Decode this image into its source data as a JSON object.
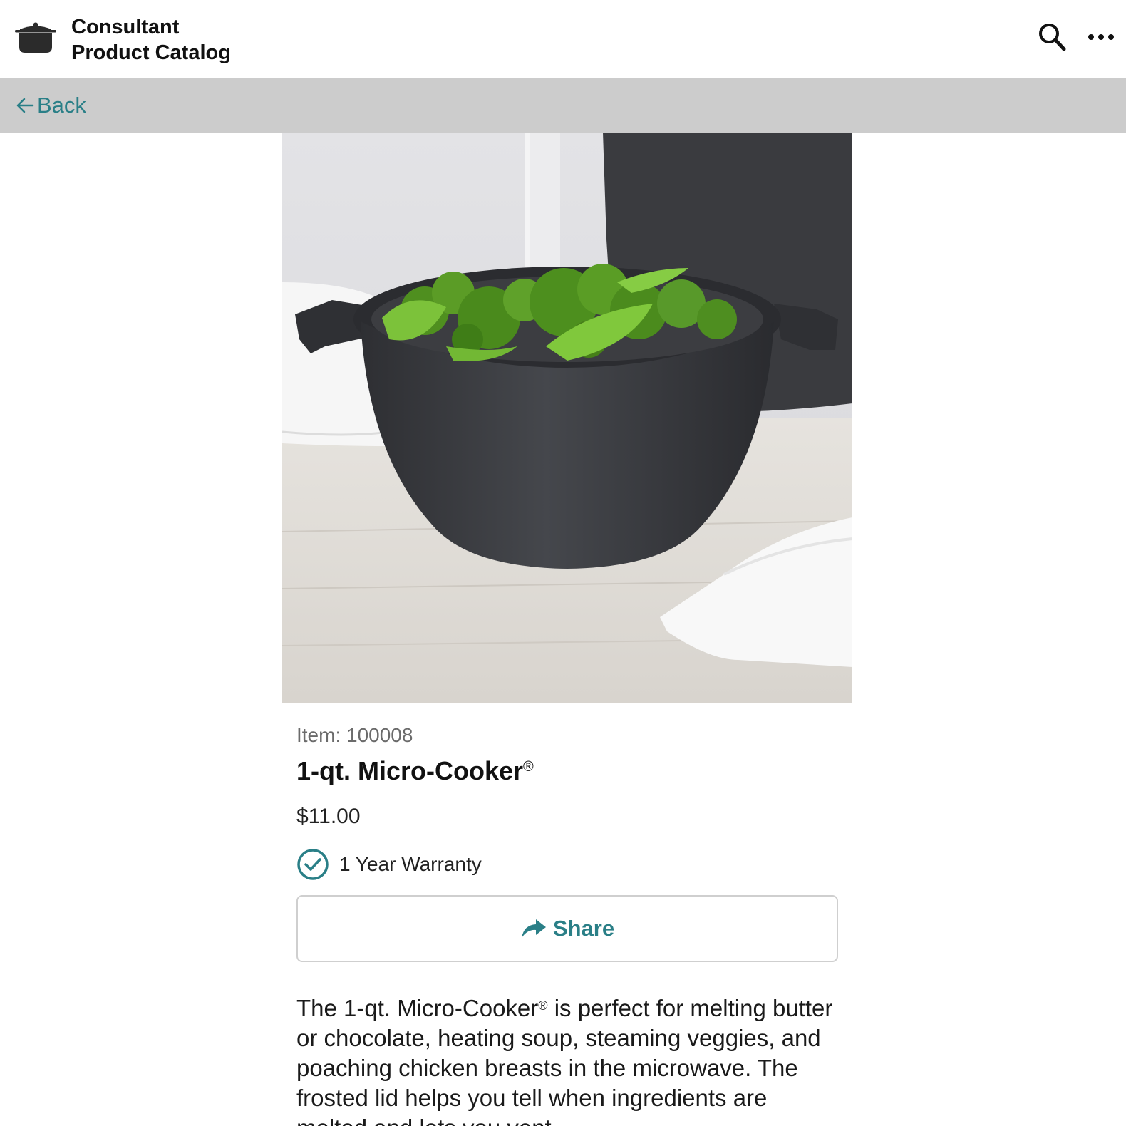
{
  "header": {
    "title_line1": "Consultant",
    "title_line2": "Product Catalog",
    "logo_icon": "pot-icon",
    "search_icon": "search-icon",
    "more_icon": "more-icon"
  },
  "nav": {
    "back_label": "Back",
    "back_icon": "arrow-left-icon"
  },
  "product": {
    "image_alt": "1-qt. Micro-Cooker with broccoli and snow peas",
    "item_label": "Item: 100008",
    "title": "1-qt. Micro-Cooker",
    "title_mark": "®",
    "price": "$11.00",
    "warranty": "1 Year Warranty",
    "warranty_icon": "check-circle-icon",
    "share_label": "Share",
    "share_icon": "share-arrow-icon",
    "description_part1": "The 1-qt. Micro-Cooker",
    "description_mark": "®",
    "description_part2": " is perfect for melting butter or chocolate, heating soup, steaming veggies, and poaching chicken breasts in the microwave. The frosted lid helps you tell when ingredients are melted and lets you vent"
  },
  "colors": {
    "accent": "#2a7f87",
    "back_bar": "#cccccc",
    "text": "#1a1a1a",
    "muted": "#6b6b6b"
  }
}
